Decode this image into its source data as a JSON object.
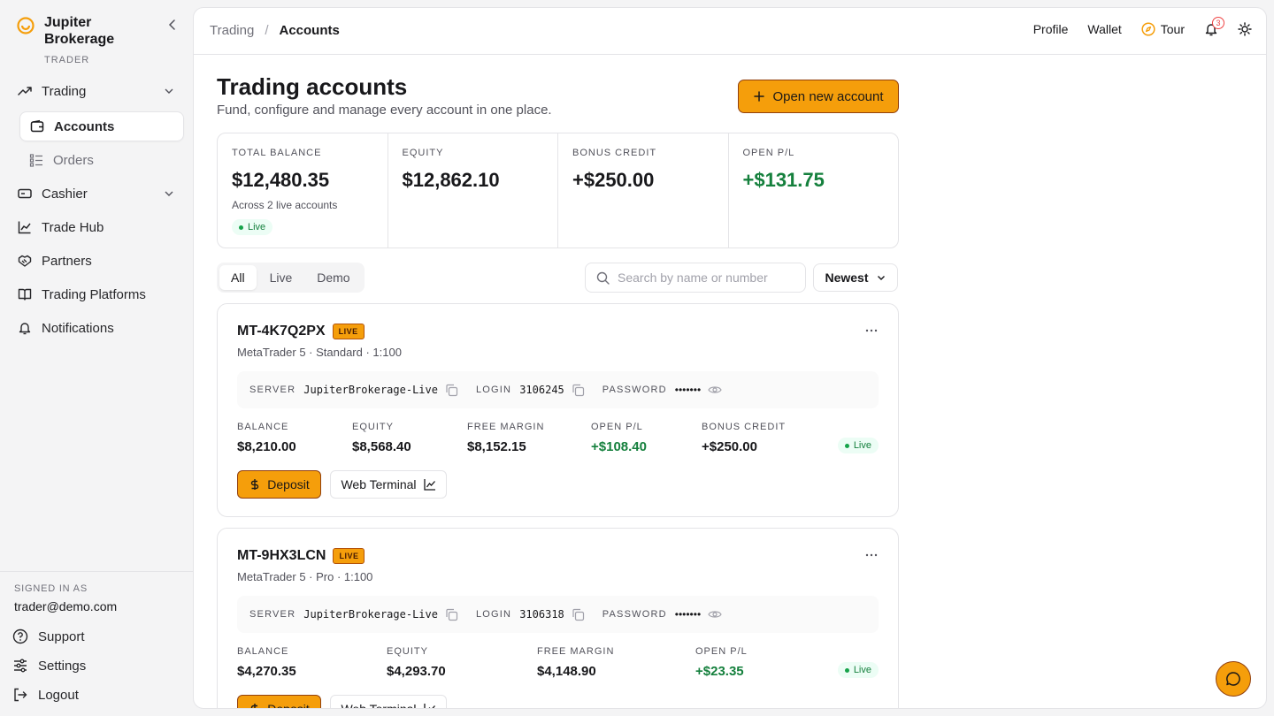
{
  "brand": {
    "name": "Jupiter Brokerage",
    "role": "TRADER"
  },
  "sidebar": {
    "items": [
      {
        "label": "Trading",
        "icon": "trending-up-icon"
      },
      {
        "label": "Accounts",
        "icon": "wallet-icon"
      },
      {
        "label": "Orders",
        "icon": "list-icon"
      },
      {
        "label": "Cashier",
        "icon": "credit-card-icon"
      },
      {
        "label": "Trade Hub",
        "icon": "chart-icon"
      },
      {
        "label": "Partners",
        "icon": "handshake-icon"
      },
      {
        "label": "Trading Platforms",
        "icon": "book-icon"
      },
      {
        "label": "Notifications",
        "icon": "bell-icon"
      }
    ],
    "signed_in_label": "SIGNED IN AS",
    "email": "trader@demo.com",
    "footer": [
      "Support",
      "Settings",
      "Logout"
    ]
  },
  "breadcrumb": {
    "parent": "Trading",
    "sep": "/",
    "current": "Accounts"
  },
  "topbar": {
    "profile": "Profile",
    "wallet": "Wallet",
    "tour": "Tour",
    "notif_count": "3"
  },
  "page": {
    "title": "Trading accounts",
    "subtitle": "Fund, configure and manage every account in one place.",
    "open_button": "Open new account"
  },
  "stats": [
    {
      "label": "TOTAL BALANCE",
      "value": "$12,480.35",
      "note": "Across 2 live accounts",
      "badge": "Live"
    },
    {
      "label": "EQUITY",
      "value": "$12,862.10"
    },
    {
      "label": "BONUS CREDIT",
      "value": "+$250.00"
    },
    {
      "label": "OPEN P/L",
      "value": "+$131.75"
    }
  ],
  "filters": {
    "tabs": [
      "All",
      "Live",
      "Demo"
    ],
    "search_placeholder": "Search by name or number",
    "sort": "Newest"
  },
  "accounts": [
    {
      "id": "MT-4K7Q2PX",
      "tag": "LIVE",
      "meta": "MetaTrader 5 · Standard · 1:100",
      "server_label": "SERVER",
      "server": "JupiterBrokerage-Live",
      "login_label": "LOGIN",
      "login": "3106245",
      "password_label": "PASSWORD",
      "password": "•••••••",
      "figures": [
        {
          "label": "BALANCE",
          "value": "$8,210.00"
        },
        {
          "label": "EQUITY",
          "value": "$8,568.40"
        },
        {
          "label": "FREE MARGIN",
          "value": "$8,152.15"
        },
        {
          "label": "OPEN P/L",
          "value": "+$108.40"
        },
        {
          "label": "BONUS CREDIT",
          "value": "+$250.00"
        }
      ],
      "status": "Live",
      "deposit": "Deposit",
      "web_terminal": "Web Terminal"
    },
    {
      "id": "MT-9HX3LCN",
      "tag": "LIVE",
      "meta": "MetaTrader 5 · Pro · 1:100",
      "server_label": "SERVER",
      "server": "JupiterBrokerage-Live",
      "login_label": "LOGIN",
      "login": "3106318",
      "password_label": "PASSWORD",
      "password": "•••••••",
      "figures": [
        {
          "label": "BALANCE",
          "value": "$4,270.35"
        },
        {
          "label": "EQUITY",
          "value": "$4,293.70"
        },
        {
          "label": "FREE MARGIN",
          "value": "$4,148.90"
        },
        {
          "label": "OPEN P/L",
          "value": "+$23.35"
        }
      ],
      "status": "Live",
      "deposit": "Deposit",
      "web_terminal": "Web Terminal"
    }
  ],
  "colors": {
    "accent": "#f59e0b",
    "positive": "#15803d",
    "border": "#e4e4e7"
  }
}
